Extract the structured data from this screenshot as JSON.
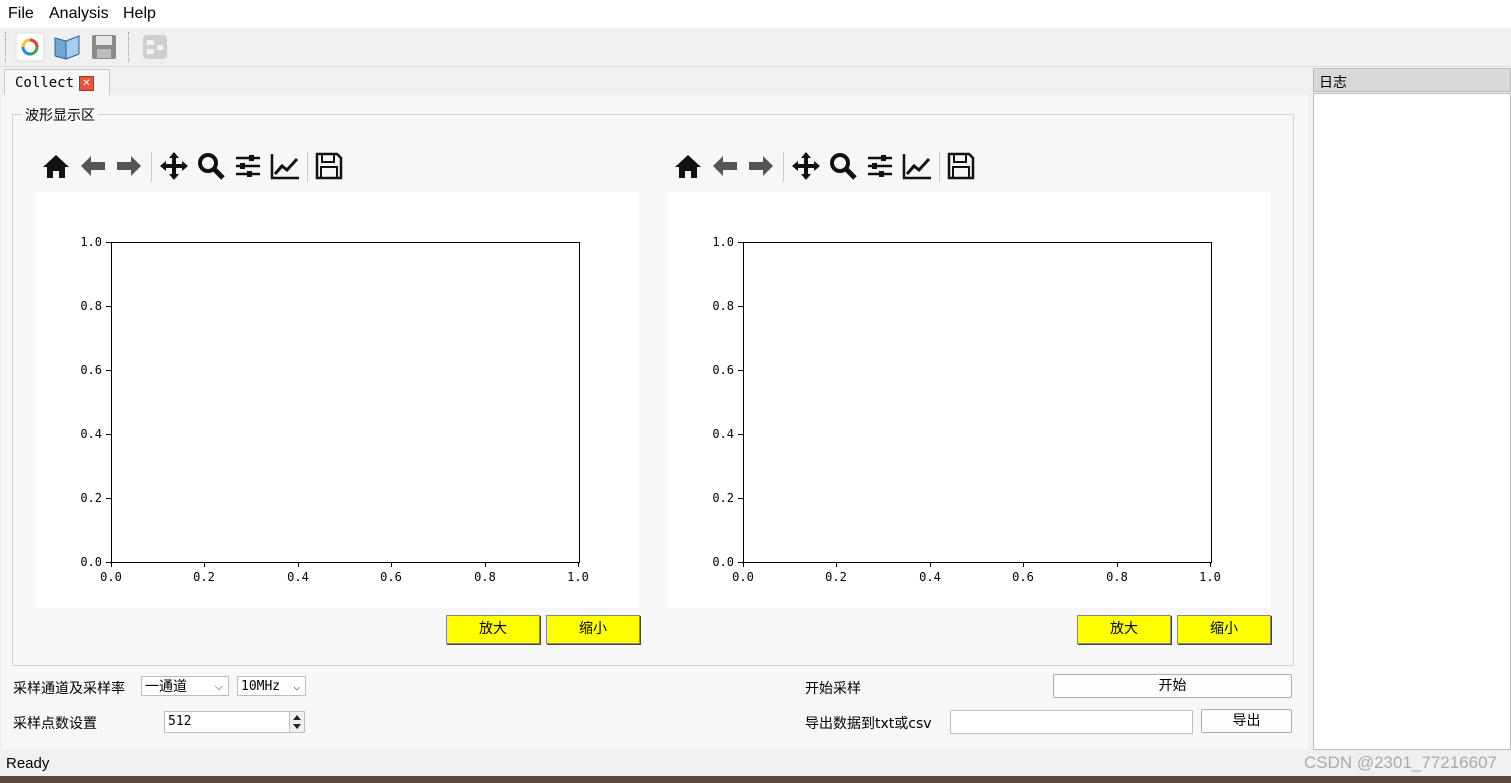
{
  "menu": {
    "file": "File",
    "analysis": "Analysis",
    "help": "Help"
  },
  "toolbar": {
    "icons": [
      "refresh-icon",
      "book-icon",
      "save-icon",
      "config-icon"
    ]
  },
  "tab": {
    "label": "Collect"
  },
  "groupbox": {
    "title": "波形显示区"
  },
  "plots": [
    {
      "yticks": [
        "1.0",
        "0.8",
        "0.6",
        "0.4",
        "0.2",
        "0.0"
      ],
      "xticks": [
        "0.0",
        "0.2",
        "0.4",
        "0.6",
        "0.8",
        "1.0"
      ],
      "zoom_in": "放大",
      "zoom_out": "缩小"
    },
    {
      "yticks": [
        "1.0",
        "0.8",
        "0.6",
        "0.4",
        "0.2",
        "0.0"
      ],
      "xticks": [
        "0.0",
        "0.2",
        "0.4",
        "0.6",
        "0.8",
        "1.0"
      ],
      "zoom_in": "放大",
      "zoom_out": "缩小"
    }
  ],
  "controls": {
    "channel_rate_label": "采样通道及采样率",
    "channel_value": "一通道",
    "rate_value": "10MHz",
    "points_label": "采样点数设置",
    "points_value": "512",
    "start_label": "开始采样",
    "start_button": "开始",
    "export_label": "导出数据到txt或csv",
    "export_value": "",
    "export_button": "导出"
  },
  "log": {
    "title": "日志"
  },
  "status": {
    "text": "Ready"
  },
  "watermark": "CSDN @2301_77216607"
}
